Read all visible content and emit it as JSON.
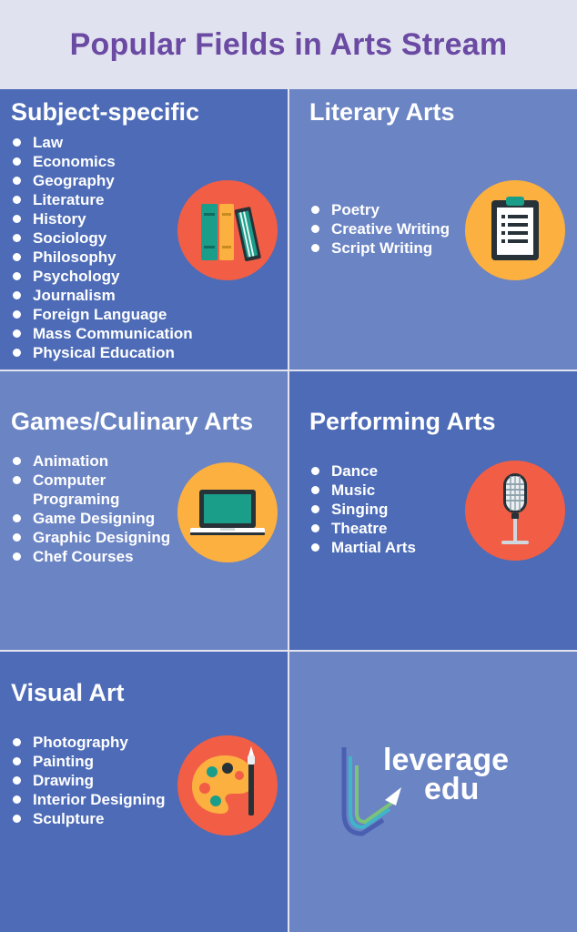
{
  "title": "Popular Fields in Arts Stream",
  "panels": {
    "subject": {
      "heading": "Subject-specific",
      "items": [
        "Law",
        "Economics",
        "Geography",
        "Literature",
        "History",
        "Sociology",
        "Philosophy",
        "Psychology",
        "Journalism",
        "Foreign Language",
        "Mass Communication",
        "Physical Education"
      ],
      "icon": "books-icon"
    },
    "literary": {
      "heading": "Literary Arts",
      "items": [
        "Poetry",
        "Creative Writing",
        "Script Writing"
      ],
      "icon": "clipboard-icon"
    },
    "games": {
      "heading": "Games/Culinary Arts",
      "items": [
        "Animation",
        "Computer Programing",
        "Game Designing",
        "Graphic Designing",
        "Chef Courses"
      ],
      "icon": "laptop-icon"
    },
    "performing": {
      "heading": "Performing Arts",
      "items": [
        "Dance",
        "Music",
        "Singing",
        "Theatre",
        "Martial Arts"
      ],
      "icon": "microphone-icon"
    },
    "visual": {
      "heading": "Visual Art",
      "items": [
        "Photography",
        "Painting",
        "Drawing",
        "Interior Designing",
        "Sculpture"
      ],
      "icon": "palette-icon"
    }
  },
  "logo": {
    "line1": "leverage",
    "line2": "edu"
  },
  "colors": {
    "title": "#6a4aa3",
    "panel_dark": "#4d6bb7",
    "panel_light": "#6b84c4",
    "circle_orange": "#f15e45",
    "circle_yellow": "#fbb040"
  }
}
